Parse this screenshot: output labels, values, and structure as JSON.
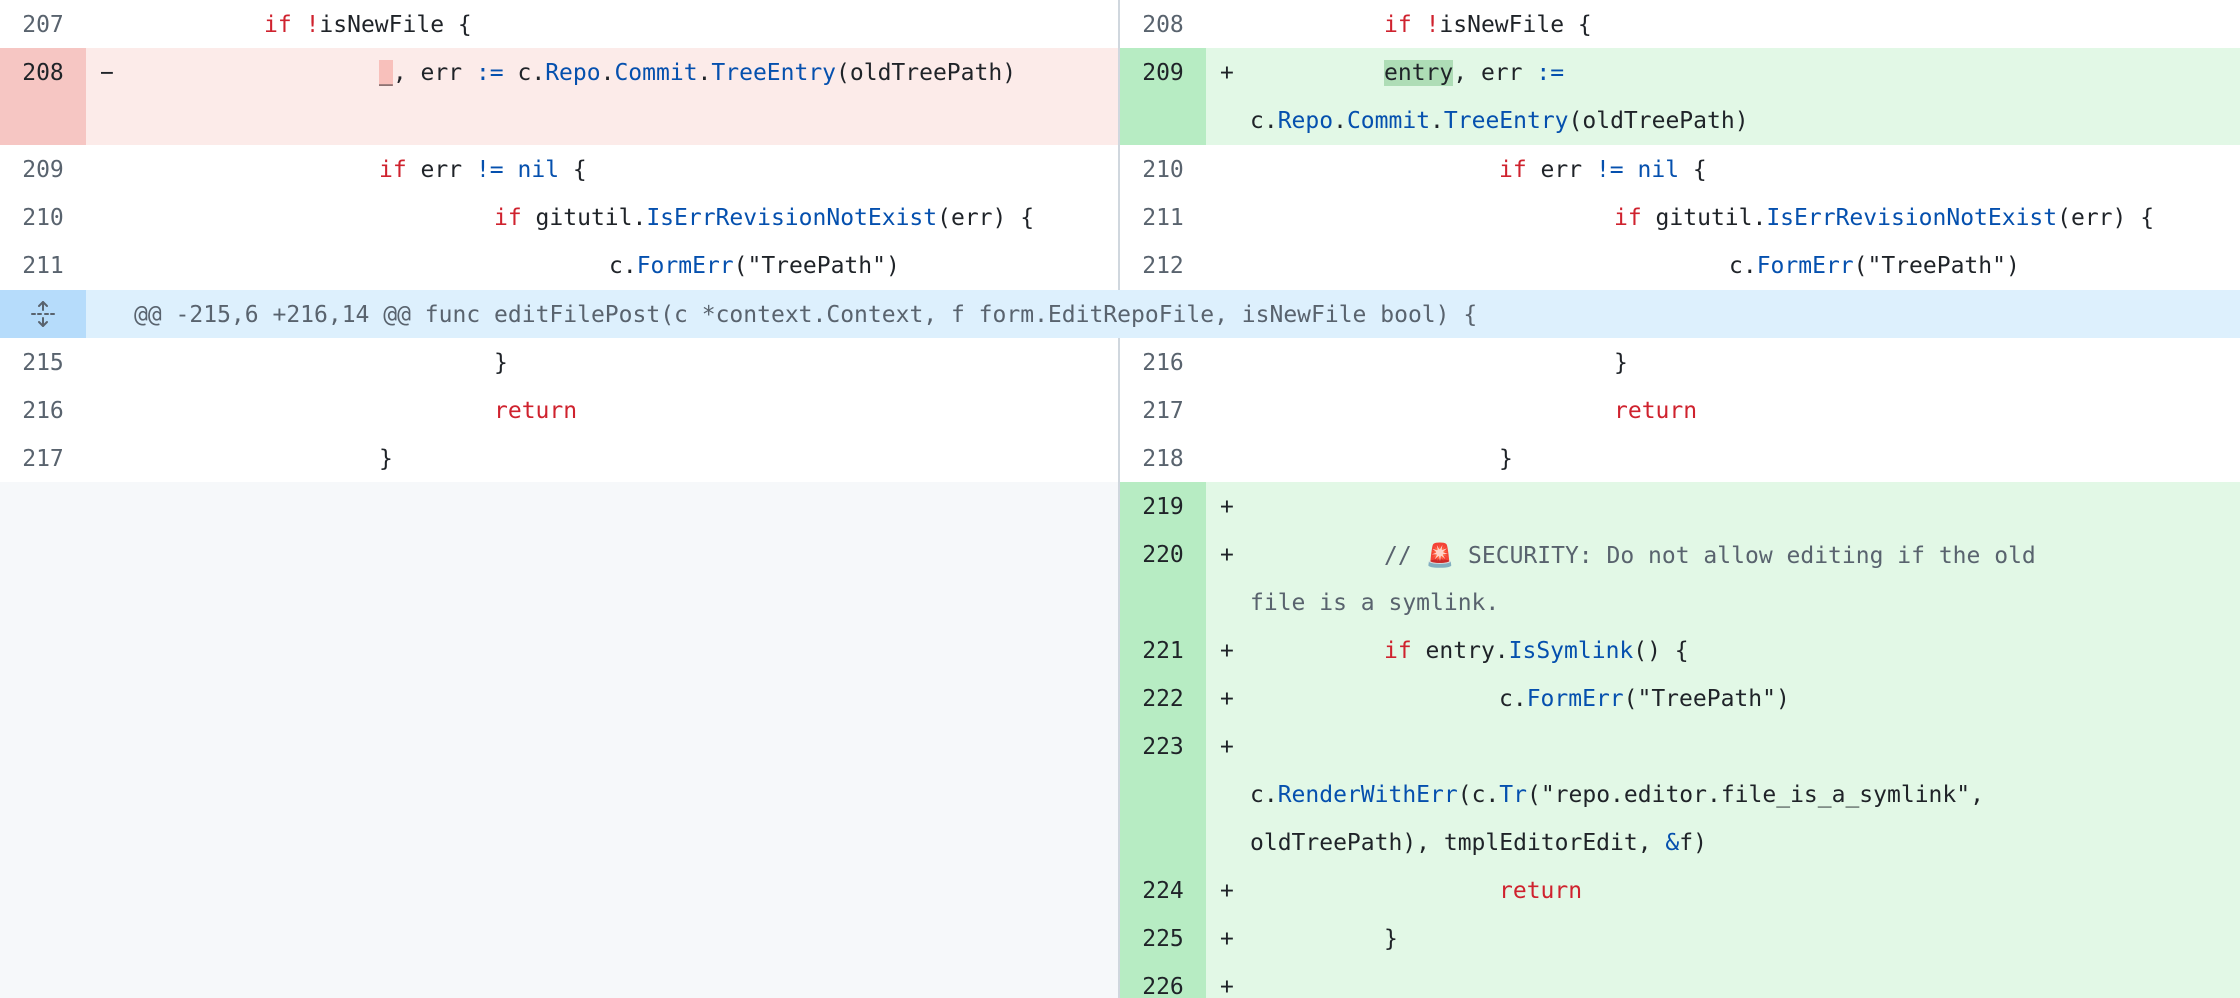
{
  "hunk": {
    "icon": "unfold-icon",
    "header": "@@ -215,6 +216,14 @@ func editFilePost(c *context.Context, f form.EditRepoFile, isNewFile bool) {"
  },
  "left": {
    "n207": "207",
    "n208": "208",
    "n209": "209",
    "n210": "210",
    "n211": "211",
    "n215": "215",
    "n216": "216",
    "n217": "217",
    "marker_del": "−"
  },
  "right": {
    "n208": "208",
    "n209": "209",
    "n210": "210",
    "n211": "211",
    "n212": "212",
    "n216": "216",
    "n217": "217",
    "n218": "218",
    "n219": "219",
    "n220": "220",
    "n221": "221",
    "n222": "222",
    "n223": "223",
    "n224": "224",
    "n225": "225",
    "n226": "226",
    "marker_add": "+"
  },
  "tokens": {
    "if": "if",
    "not": "!",
    "isNewFile": "isNewFile {",
    "underscore": "_",
    "commaErr": ", err ",
    "assign": ":=",
    "cdot": " c.",
    "Repo": "Repo",
    "dot": ".",
    "Commit": "Commit",
    "TreeEntry": "TreeEntry",
    "oldTreePathParen": "(oldTreePath)",
    "entry": "entry",
    "c": "c.",
    "errSp": " err ",
    "neq": "!=",
    "nil": "nil",
    "brace": " {",
    "gitutil": " gitutil.",
    "IsErrRevisionNotExist": "IsErrRevisionNotExist",
    "errParenBrace": "(err) {",
    "FormErr": "FormErr",
    "treePathArg": "(\"TreePath\")",
    "closeBrace": "}",
    "return": "return",
    "comment1": "// 🚨 SECURITY: Do not allow editing if the old",
    "comment2": "file is a symlink.",
    "entryDot": " entry.",
    "IsSymlink": "IsSymlink",
    "parensBrace": "() {",
    "RenderWithErr": "RenderWithErr",
    "cParen": "(c.",
    "Tr": "Tr",
    "trArgs": "(\"repo.editor.file_is_a_symlink\",",
    "oldTreePathTail": "oldTreePath), tmplEditorEdit, ",
    "amp": "&",
    "fParen": "f)"
  }
}
